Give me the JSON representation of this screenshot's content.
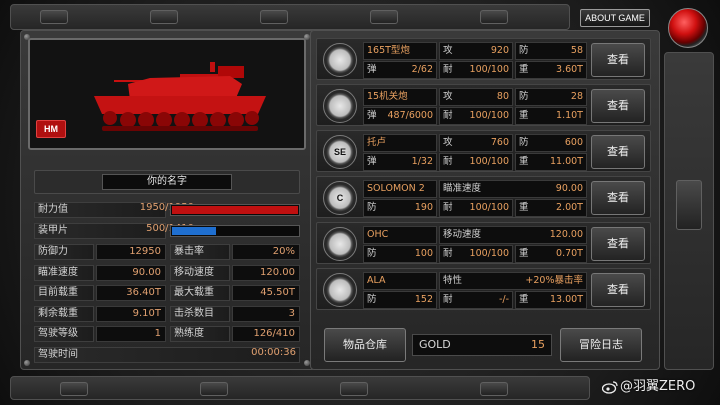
{
  "header": {
    "about_label": "ABOUT GAME"
  },
  "tank": {
    "badge": "HM"
  },
  "pilot": {
    "name": "你的名字"
  },
  "stats": {
    "durability": {
      "label": "耐力值",
      "value": "1950/1950",
      "fraction": 1.0,
      "color": "#c01010"
    },
    "armor": {
      "label": "装甲片",
      "value": "500/1410",
      "fraction": 0.35,
      "color": "#1f6fd0"
    },
    "grid": [
      {
        "label": "防御力",
        "value": "12950",
        "label2": "暴击率",
        "value2": "20%"
      },
      {
        "label": "瞄准速度",
        "value": "90.00",
        "label2": "移动速度",
        "value2": "120.00"
      },
      {
        "label": "目前载重",
        "value": "36.40T",
        "label2": "最大载重",
        "value2": "45.50T"
      },
      {
        "label": "剩余载重",
        "value": "9.10T",
        "label2": "击杀数目",
        "value2": "3"
      },
      {
        "label": "驾驶等级",
        "value": "1",
        "label2": "熟练度",
        "value2": "126/410"
      }
    ],
    "drive_time": {
      "label": "驾驶时间",
      "value": "00:00:36"
    }
  },
  "items": [
    {
      "icon": "cannon-icon",
      "icon_text": "",
      "name": "165T型炮",
      "r1": [
        {
          "k": "攻",
          "v": "920"
        },
        {
          "k": "防",
          "v": "58"
        }
      ],
      "r2": [
        {
          "k": "弹",
          "v": "2/62"
        },
        {
          "k": "耐",
          "v": "100/100"
        },
        {
          "k": "重",
          "v": "3.60T"
        }
      ],
      "button": "查看"
    },
    {
      "icon": "machinegun-icon",
      "icon_text": "",
      "name": "15机关炮",
      "r1": [
        {
          "k": "攻",
          "v": "80"
        },
        {
          "k": "防",
          "v": "28"
        }
      ],
      "r2": [
        {
          "k": "弹",
          "v": "487/6000"
        },
        {
          "k": "耐",
          "v": "100/100"
        },
        {
          "k": "重",
          "v": "1.10T"
        }
      ],
      "button": "查看"
    },
    {
      "icon": "special-weapon-icon",
      "icon_text": "SE",
      "name": "托卢",
      "r1": [
        {
          "k": "攻",
          "v": "760"
        },
        {
          "k": "防",
          "v": "600"
        }
      ],
      "r2": [
        {
          "k": "弹",
          "v": "1/32"
        },
        {
          "k": "耐",
          "v": "100/100"
        },
        {
          "k": "重",
          "v": "11.00T"
        }
      ],
      "button": "查看"
    },
    {
      "icon": "c-unit-icon",
      "icon_text": "C",
      "name": "SOLOMON 2",
      "r1": [
        {
          "k": "瞄准速度",
          "v": "90.00"
        }
      ],
      "r2": [
        {
          "k": "防",
          "v": "190"
        },
        {
          "k": "耐",
          "v": "100/100"
        },
        {
          "k": "重",
          "v": "2.00T"
        }
      ],
      "button": "查看"
    },
    {
      "icon": "engine-icon",
      "icon_text": "",
      "name": "OHC",
      "r1": [
        {
          "k": "移动速度",
          "v": "120.00"
        }
      ],
      "r2": [
        {
          "k": "防",
          "v": "100"
        },
        {
          "k": "耐",
          "v": "100/100"
        },
        {
          "k": "重",
          "v": "0.70T"
        }
      ],
      "button": "查看"
    },
    {
      "icon": "chip-icon",
      "icon_text": "",
      "name": "ALA",
      "r1": [
        {
          "k": "特性",
          "v": "+20%暴击率"
        }
      ],
      "r2": [
        {
          "k": "防",
          "v": "152"
        },
        {
          "k": "耐",
          "v": "-/-"
        },
        {
          "k": "重",
          "v": "13.00T"
        }
      ],
      "button": "查看"
    }
  ],
  "footer": {
    "warehouse": "物品仓库",
    "gold_label": "GOLD",
    "gold_value": "15",
    "log": "冒险日志"
  },
  "watermark": "@羽翼ZERO"
}
